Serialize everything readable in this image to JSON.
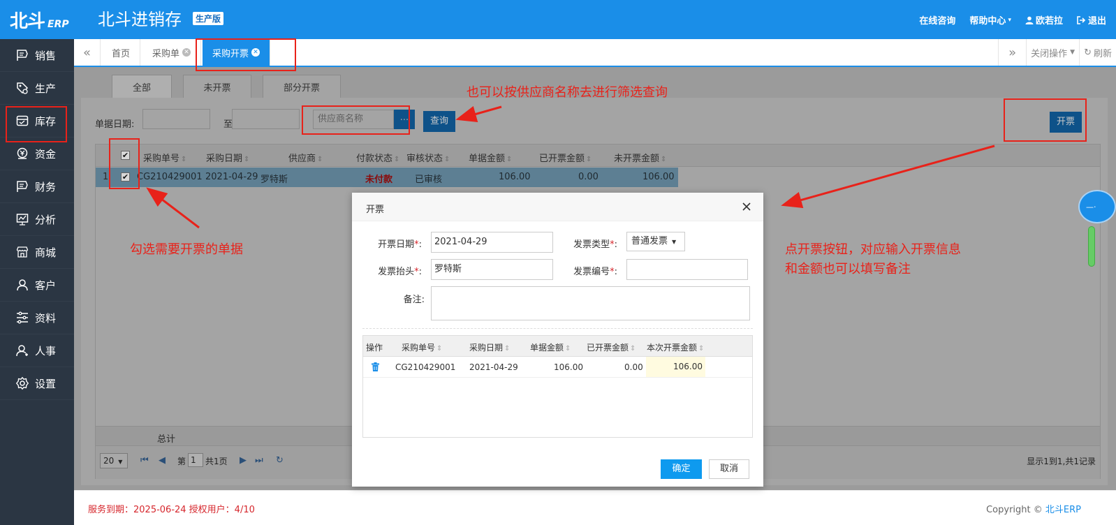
{
  "header": {
    "logo_cn": "北斗",
    "logo_en": "ERP",
    "app_title": "北斗进销存",
    "edition": "生产版",
    "nav": {
      "consult": "在线咨询",
      "help": "帮助中心",
      "user": "欧若拉",
      "logout": "退出"
    }
  },
  "sidebar": {
    "items": [
      {
        "label": "销售",
        "icon": "sales-icon"
      },
      {
        "label": "生产",
        "icon": "production-icon"
      },
      {
        "label": "库存",
        "icon": "inventory-icon"
      },
      {
        "label": "资金",
        "icon": "funds-icon"
      },
      {
        "label": "财务",
        "icon": "finance-icon"
      },
      {
        "label": "分析",
        "icon": "analysis-icon"
      },
      {
        "label": "商城",
        "icon": "mall-icon"
      },
      {
        "label": "客户",
        "icon": "customer-icon"
      },
      {
        "label": "资料",
        "icon": "data-icon"
      },
      {
        "label": "人事",
        "icon": "hr-icon"
      },
      {
        "label": "设置",
        "icon": "settings-icon"
      }
    ]
  },
  "tabs": {
    "items": [
      "首页",
      "采购单",
      "采购开票"
    ],
    "close_ops": "关闭操作",
    "refresh": "刷新"
  },
  "page": {
    "subtabs": [
      "全部",
      "未开票",
      "部分开票"
    ],
    "filter": {
      "date_label": "单据日期:",
      "to_label": "至",
      "supplier_placeholder": "供应商名称",
      "dots": "...",
      "query": "查询"
    },
    "invoice_button": "开票",
    "grid": {
      "columns": [
        "采购单号",
        "采购日期",
        "供应商",
        "付款状态",
        "审核状态",
        "单据金额",
        "已开票金额",
        "未开票金额"
      ],
      "rows": [
        {
          "index": "1",
          "order_no": "CG210429001",
          "date": "2021-04-29",
          "supplier": "罗特斯",
          "pay_status": "未付款",
          "audit_status": "已审核",
          "amount": "106.00",
          "invoiced": "0.00",
          "uninvoiced": "106.00"
        }
      ],
      "total_label": "总计",
      "pager": {
        "page_size": "20",
        "page_prefix": "第",
        "page_value": "1",
        "page_suffix": "共1页",
        "summary": "显示1到1,共1记录"
      }
    }
  },
  "modal": {
    "title": "开票",
    "fields": {
      "invoice_date_label": "开票日期",
      "invoice_date": "2021-04-29",
      "invoice_type_label": "发票类型",
      "invoice_type": "普通发票",
      "invoice_header_label": "发票抬头",
      "invoice_header": "罗特斯",
      "invoice_no_label": "发票编号",
      "invoice_no": "",
      "remark_label": "备注:"
    },
    "grid": {
      "columns": [
        "操作",
        "采购单号",
        "采购日期",
        "单据金额",
        "已开票金额",
        "本次开票金额"
      ],
      "rows": [
        {
          "order_no": "CG210429001",
          "date": "2021-04-29",
          "amount": "106.00",
          "invoiced": "0.00",
          "this_invoice": "106.00"
        }
      ]
    },
    "ok": "确定",
    "cancel": "取消"
  },
  "annotations": {
    "supplier_filter": "也可以按供应商名称去进行筛选查询",
    "select_docs": "勾选需要开票的单据",
    "invoice_hint_line1": "点开票按钮，对应输入开票信息",
    "invoice_hint_line2": "和金额也可以填写备注"
  },
  "footer": {
    "service": "服务到期：2025-06-24   授权用户：4/10",
    "copyright_prefix": "Copyright © ",
    "copyright_link": "北斗ERP"
  },
  "colors": {
    "primary": "#1a8ee8",
    "sidebar": "#2b3643",
    "annotation_red": "#e8221a"
  }
}
